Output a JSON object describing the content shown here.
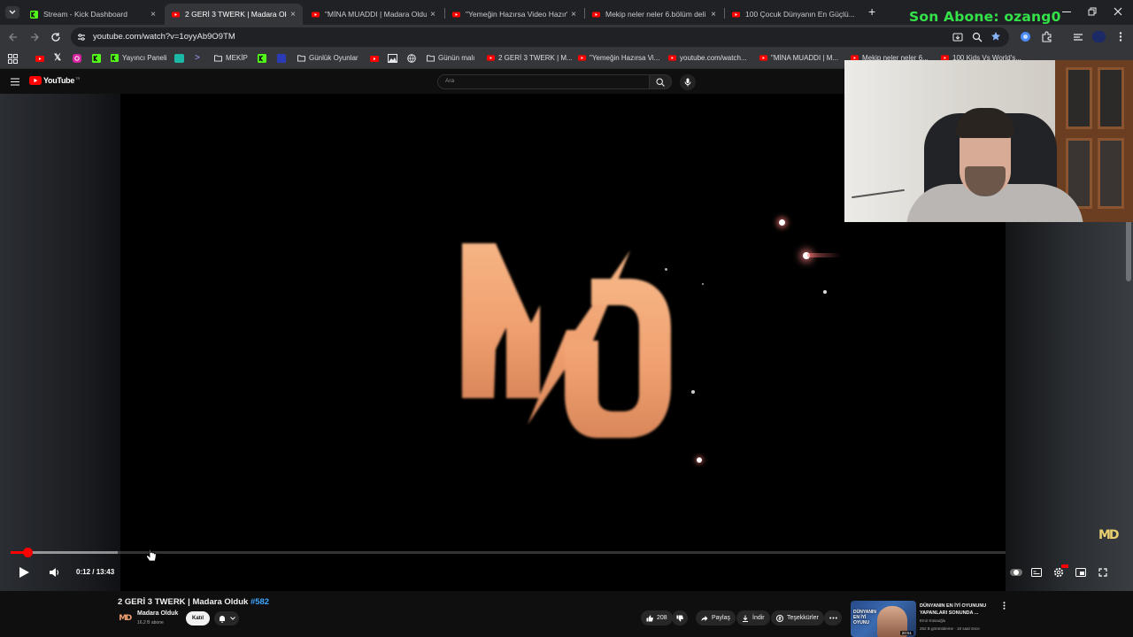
{
  "browser": {
    "tabs": [
      {
        "title": "Stream - Kick Dashboard",
        "icon": "kick-icon"
      },
      {
        "title": "2 GERİ 3 TWERK | Madara Olduk",
        "icon": "youtube-icon"
      },
      {
        "title": "\"MİNA MUADDI | Madara Olduk",
        "icon": "youtube-icon"
      },
      {
        "title": "\"Yemeğin Hazırsa Video Hazır\"",
        "icon": "youtube-icon"
      },
      {
        "title": "Mekip neler neler 6.bölüm deli",
        "icon": "youtube-icon"
      },
      {
        "title": "100 Çocuk Dünyanın En Güçlü...",
        "icon": "youtube-icon"
      }
    ],
    "new_tab_symbol": "+",
    "close_symbol": "×",
    "url": "youtube.com/watch?v=1oyyAb9O9TM",
    "bookmarks": [
      {
        "label": "Yayıncı Paneli"
      },
      {
        "label": "MEKİP"
      },
      {
        "label": "Günlük Oyunlar"
      },
      {
        "label": "Günün malı"
      },
      {
        "label": "2 GERİ 3 TWERK | M..."
      },
      {
        "label": "\"Yemeğin Hazırsa Vi..."
      },
      {
        "label": "youtube.com/watch..."
      },
      {
        "label": "\"MİNA MUADDI | M..."
      },
      {
        "label": "Mekip neler neler 6..."
      },
      {
        "label": "100 Kids Vs World's..."
      }
    ]
  },
  "youtube": {
    "logo_text": "YouTube",
    "logo_sup": "TR",
    "search_placeholder": "Ara"
  },
  "player": {
    "logo": "MD",
    "watermark": "MD",
    "progress_fraction": 0.015,
    "buffered_fraction": 0.108,
    "time_current": "0:12",
    "time_total": "13:43"
  },
  "video": {
    "title": "2 GERİ 3 TWERK | Madara Olduk",
    "hashtag": "#582",
    "channel": "Madara Olduk",
    "subscribers": "16,2 B abone",
    "join_label": "Katıl",
    "likes": "208",
    "share_label": "Paylaş",
    "download_label": "İndir",
    "thanks_label": "Teşekkürler"
  },
  "recommendation": {
    "thumb_text": "DÜNYANIN EN İYİ OYUNU",
    "duration": "20:51",
    "title": "DÜNYANIN EN İYİ OYUNUNU YAPANLARI SONUNDA ...",
    "channel": "Emir Küsaoğlu",
    "meta": "252 B görüntüleme · 18 saat önce"
  },
  "overlay": {
    "subscriber_text": "Son Abone: ozang0"
  },
  "colors": {
    "youtube_red": "#ff0000",
    "kick_green": "#53fc18",
    "overlay_green": "#34e34a",
    "logo_orange": "#f0a070",
    "link_blue": "#3ea6ff"
  }
}
